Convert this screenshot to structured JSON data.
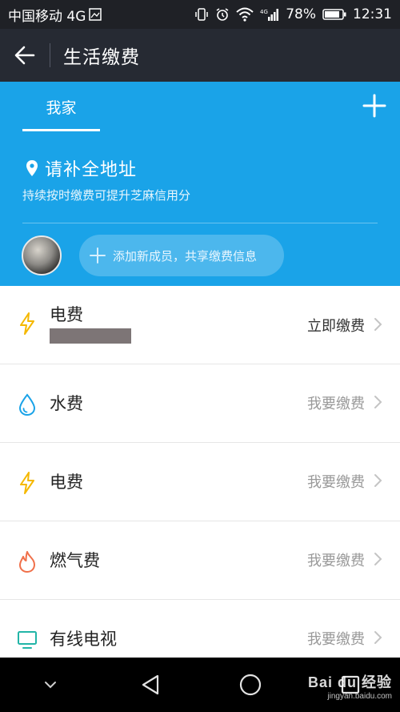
{
  "status_bar": {
    "carrier": "中国移动 4G",
    "network_tags": "4G",
    "battery": "78%",
    "time": "12:31",
    "icons": [
      "vibrate-icon",
      "alarm-icon",
      "wifi-icon",
      "signal-icon",
      "battery-icon"
    ]
  },
  "app_bar": {
    "title": "生活缴费",
    "back_icon": "arrow-left-icon"
  },
  "header": {
    "tab_label": "我家",
    "add_icon": "plus-icon",
    "address_prompt": "请补全地址",
    "address_icon": "location-pin-icon",
    "subtitle": "持续按时缴费可提升芝麻信用分",
    "add_member_label": "添加新成员，共享缴费信息",
    "add_member_icon": "plus-icon"
  },
  "bills": [
    {
      "name": "电费",
      "action": "立即缴费",
      "icon": "lightning-icon",
      "icon_color": "#f5b800",
      "account_redacted": true
    },
    {
      "name": "水费",
      "action": "我要缴费",
      "icon": "water-drop-icon",
      "icon_color": "#1aa3e8"
    },
    {
      "name": "电费",
      "action": "我要缴费",
      "icon": "lightning-icon",
      "icon_color": "#f5b800"
    },
    {
      "name": "燃气费",
      "action": "我要缴费",
      "icon": "flame-icon",
      "icon_color": "#f0704a"
    },
    {
      "name": "有线电视",
      "action": "我要缴费",
      "icon": "tv-icon",
      "icon_color": "#22b5a7"
    }
  ],
  "watermark": {
    "main": "Bai du 经验",
    "sub": "jingyan.baidu.com"
  },
  "colors": {
    "header_blue": "#1aa3e8",
    "app_bar": "#262a33",
    "status_bar": "#1f2126"
  }
}
